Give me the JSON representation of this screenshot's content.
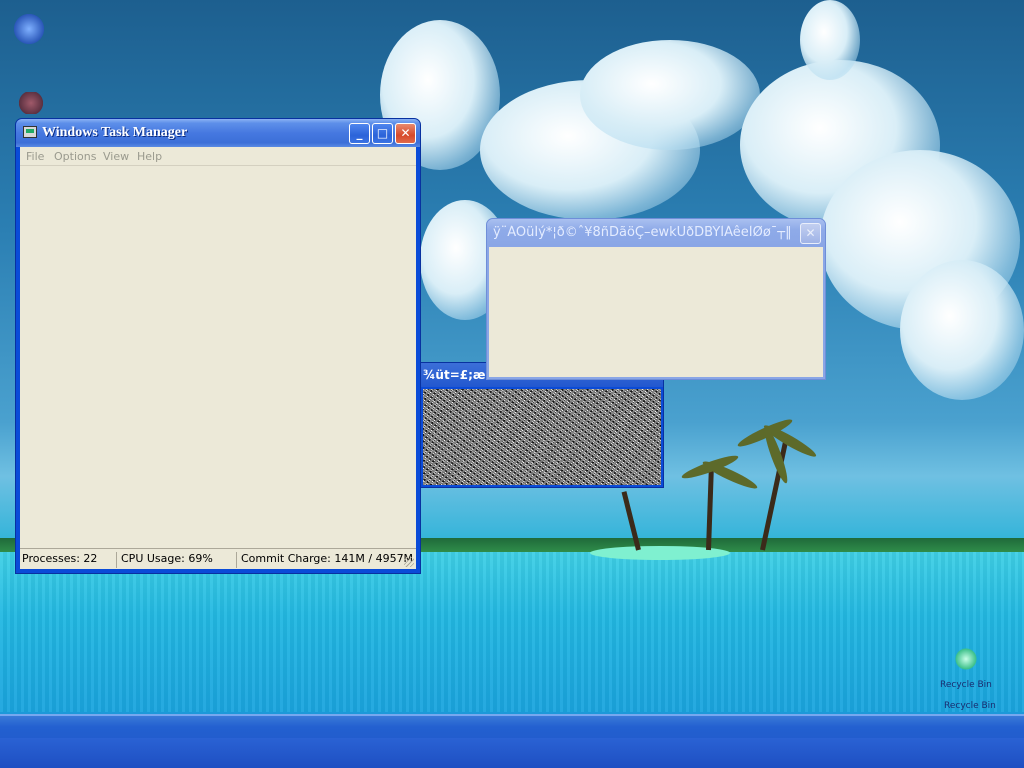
{
  "task_manager": {
    "title": "Windows Task Manager",
    "menu": [
      "File",
      "Options",
      "View",
      "Help"
    ],
    "status": {
      "processes": "Processes: 22",
      "cpu": "CPU Usage: 69%",
      "commit": "Commit Charge: 141M / 4957M"
    },
    "buttons": {
      "minimize": "_",
      "maximize": "□",
      "close": "✕"
    }
  },
  "dialog": {
    "title": "ÿ¨ÁÖüÍý*¦ð©ˆ¥8ñDãöÇ–ewkÚðDBÝÌÁêeÌØø¯┬‖...",
    "close": "✕"
  },
  "noise_window": {
    "title": "¾üt=£;æ«"
  },
  "desktop": {
    "icon_labels": [
      "Recycle Bin",
      "Recycle Bin"
    ]
  }
}
